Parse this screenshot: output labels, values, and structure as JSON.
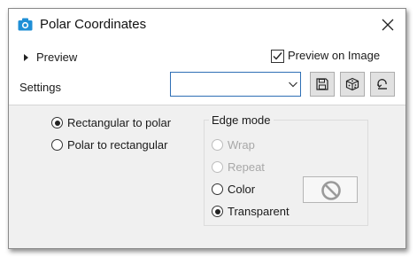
{
  "window": {
    "title": "Polar Coordinates",
    "icon": "camera-icon",
    "close_icon": "close-icon"
  },
  "top": {
    "preview_label": "Preview",
    "preview_on_image_label": "Preview on Image",
    "preview_on_image_checked": true,
    "settings_label": "Settings",
    "settings_value": "",
    "buttons": [
      "save-icon",
      "dice-icon",
      "reset-icon"
    ]
  },
  "mode": {
    "options": [
      {
        "label": "Rectangular to polar",
        "selected": true
      },
      {
        "label": "Polar to rectangular",
        "selected": false
      }
    ]
  },
  "edge_mode": {
    "title": "Edge mode",
    "options": [
      {
        "label": "Wrap",
        "selected": false,
        "disabled": true
      },
      {
        "label": "Repeat",
        "selected": false,
        "disabled": true
      },
      {
        "label": "Color",
        "selected": false,
        "disabled": false
      },
      {
        "label": "Transparent",
        "selected": true,
        "disabled": false
      }
    ],
    "color_swatch_icon": "no-color-icon"
  },
  "colors": {
    "accent": "#2f6fb5",
    "panel": "#f0f0f0",
    "disabled_text": "#a8a8a8"
  }
}
